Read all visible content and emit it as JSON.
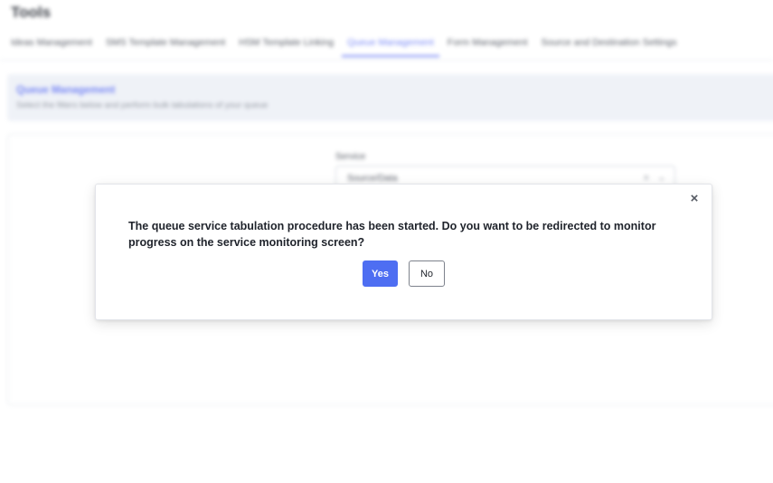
{
  "page": {
    "title": "Tools"
  },
  "tabs": [
    {
      "label": "Ideas Management"
    },
    {
      "label": "SMS Template Management"
    },
    {
      "label": "HSM Template Linking"
    },
    {
      "label": "Queue Management"
    },
    {
      "label": "Form Management"
    },
    {
      "label": "Source and Destination Settings"
    }
  ],
  "active_tab_index": 3,
  "info_card": {
    "title": "Queue Management",
    "subtitle": "Select the filters below and perform bulk tabulations of your queue"
  },
  "form": {
    "service_label": "Service",
    "service_value": "Source/Data",
    "clear_glyph": "×",
    "caret_glyph": "⌄"
  },
  "modal": {
    "message": "The queue service tabulation procedure has been started. Do you want to be redirected to monitor progress on the service monitoring screen?",
    "yes_label": "Yes",
    "no_label": "No",
    "close_glyph": "×"
  },
  "colors": {
    "accent": "#4e6ef2",
    "tab_active": "#6b7cf5"
  }
}
